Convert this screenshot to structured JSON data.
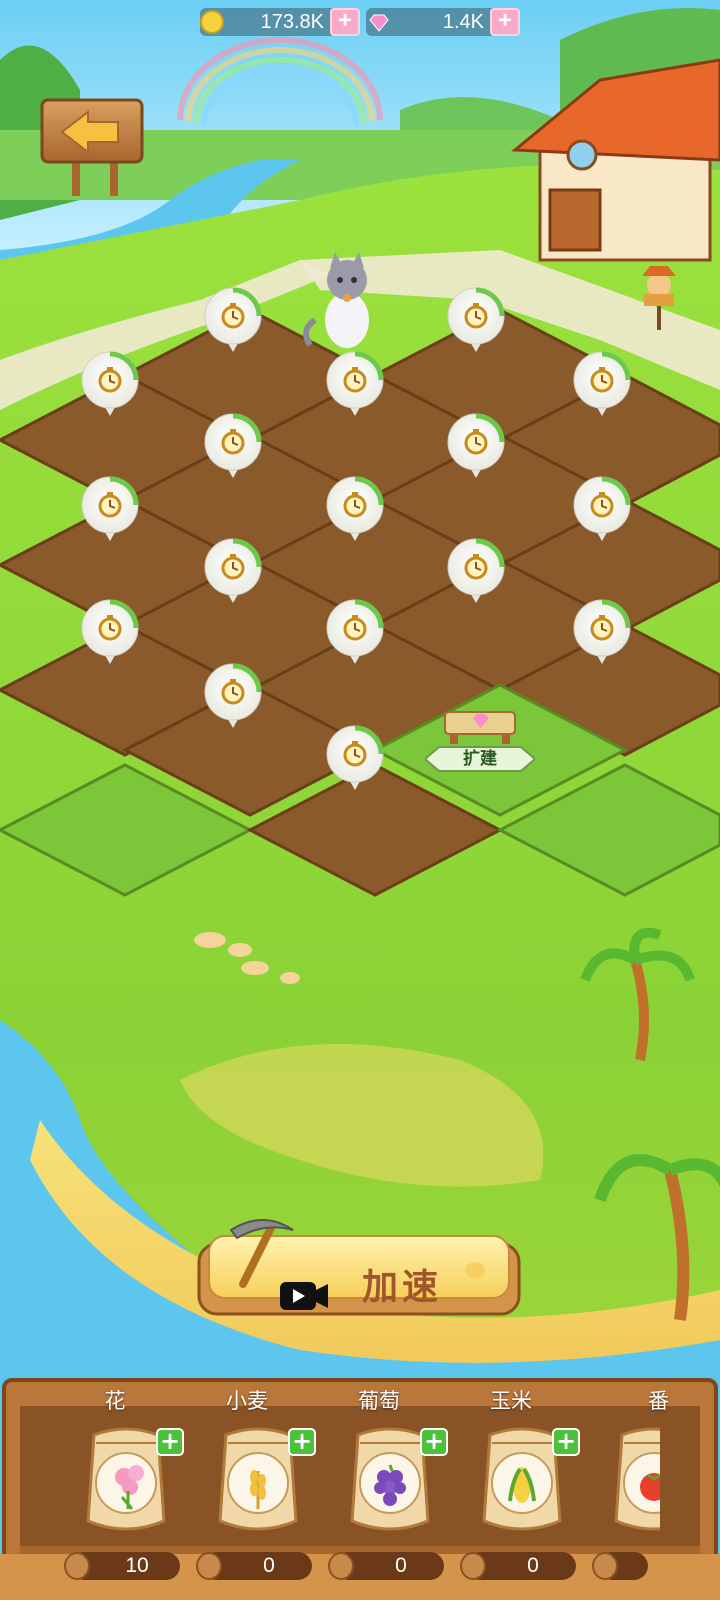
{
  "currency": {
    "coins": "173.8K",
    "gems": "1.4K"
  },
  "farm": {
    "expand_label": "扩建"
  },
  "speed_button": {
    "label": "加速"
  },
  "seeds": [
    {
      "name": "花",
      "count": "10",
      "icon": "flower-icon"
    },
    {
      "name": "小麦",
      "count": "0",
      "icon": "wheat-icon"
    },
    {
      "name": "葡萄",
      "count": "0",
      "icon": "grape-icon"
    },
    {
      "name": "玉米",
      "count": "0",
      "icon": "corn-icon"
    },
    {
      "name": "番",
      "count": "",
      "icon": "tomato-icon"
    }
  ],
  "colors": {
    "grass": "#8cd23c",
    "soil": "#7a4a22",
    "wood": "#c88a4a",
    "sky": "#7fd4f0"
  }
}
